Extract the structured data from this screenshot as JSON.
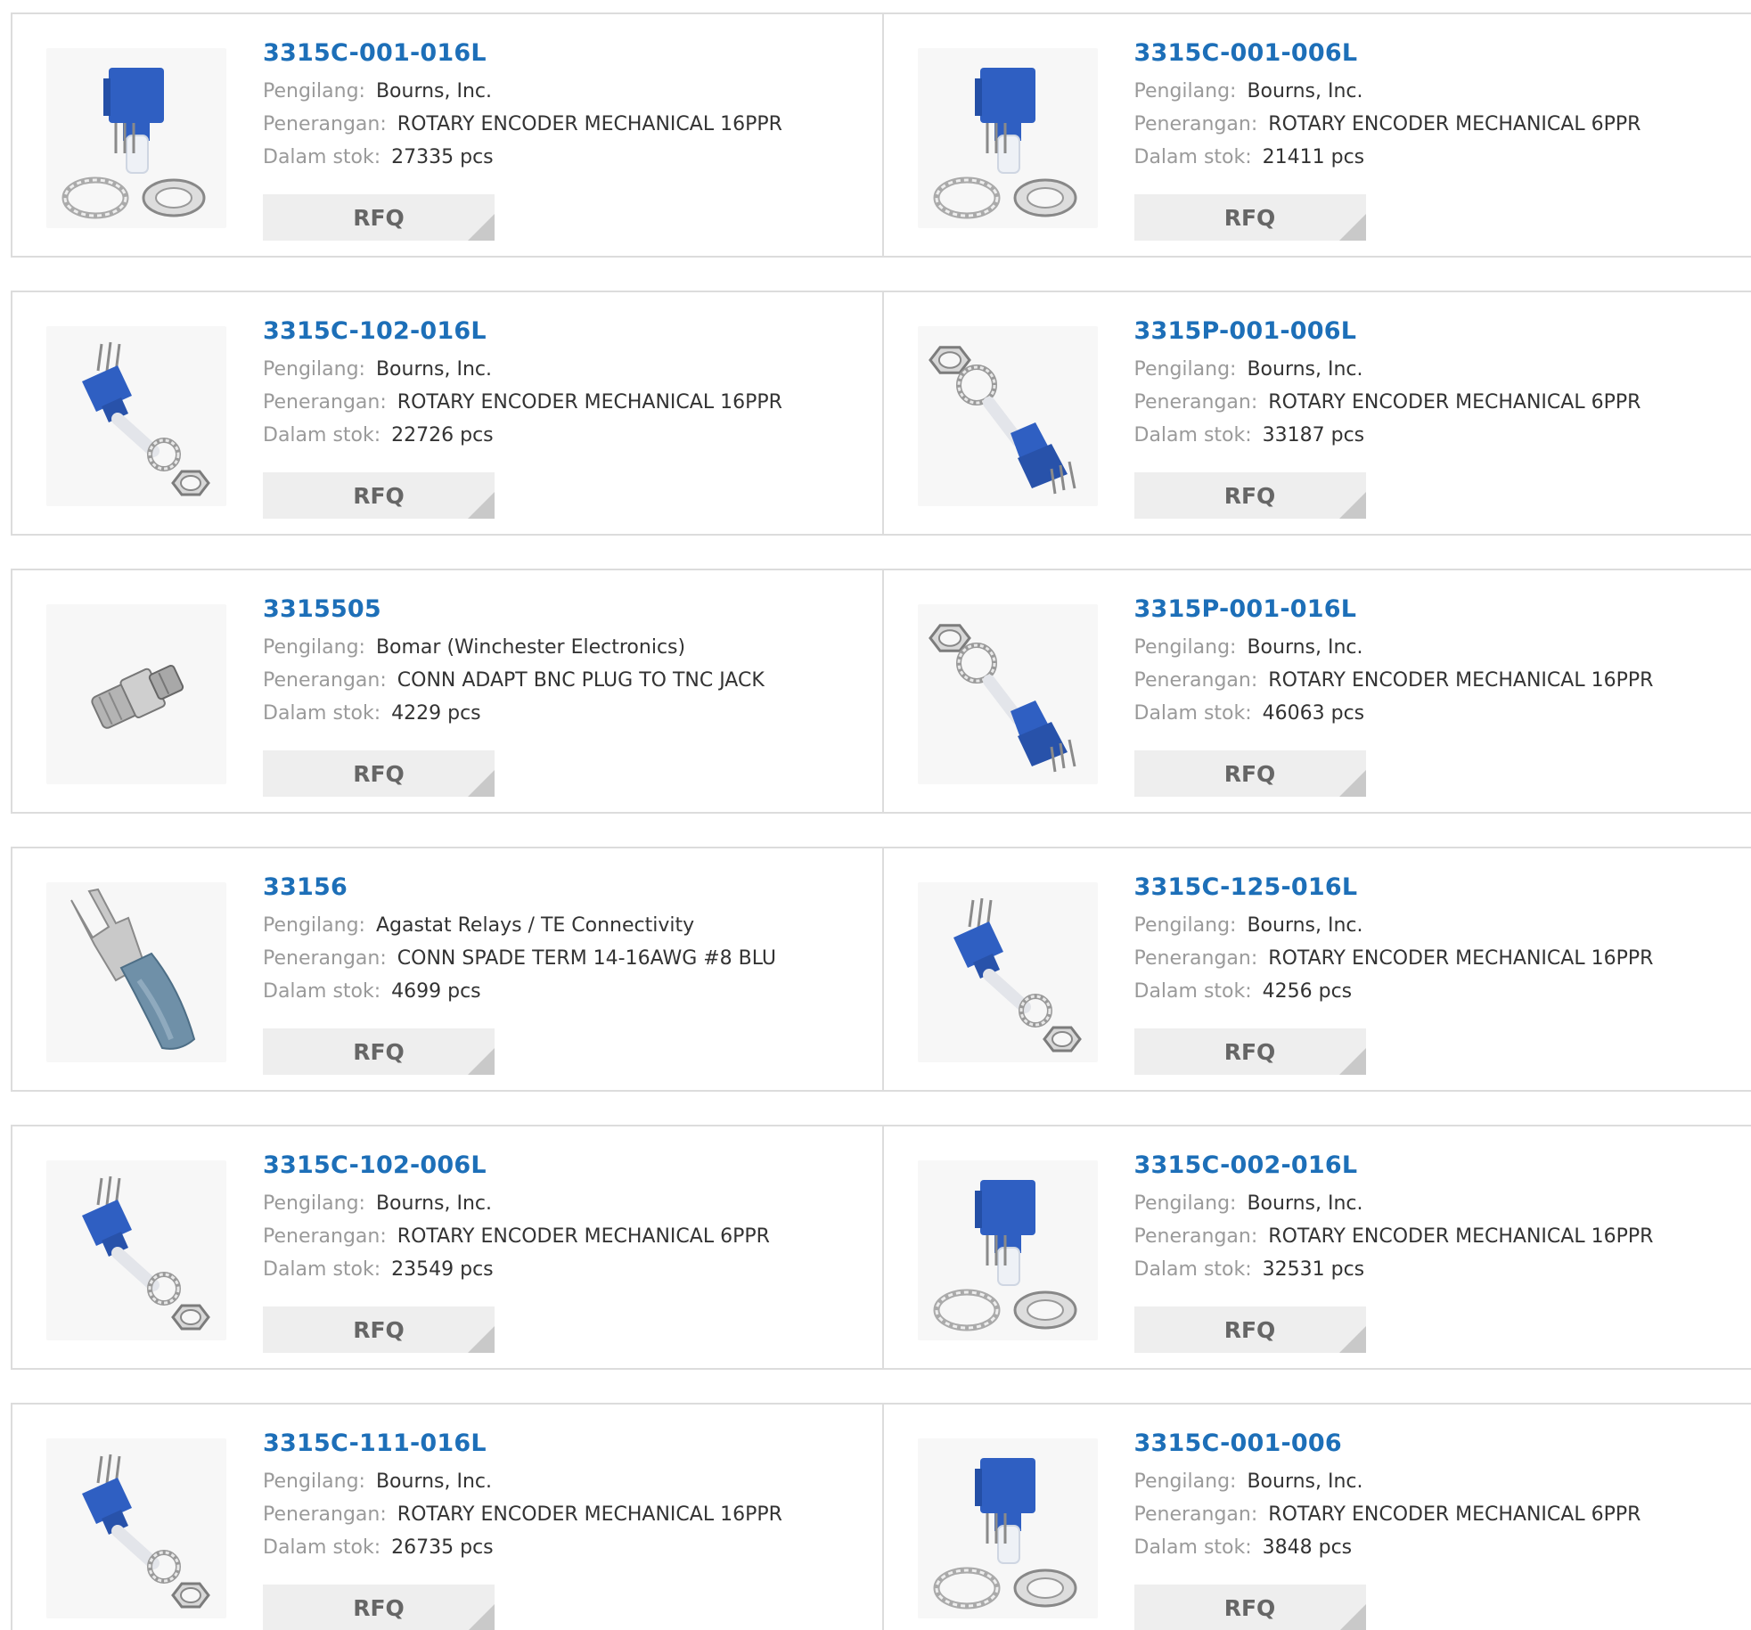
{
  "labels": {
    "manufacturer": "Pengilang:",
    "description": "Penerangan:",
    "stock": "Dalam stok:",
    "rfq": "RFQ"
  },
  "colors": {
    "link": "#1d6fb8",
    "encoder_blue": "#2f5fc2"
  },
  "products": [
    {
      "part": "3315C-001-016L",
      "manufacturer": "Bourns, Inc.",
      "description": "ROTARY ENCODER MECHANICAL 16PPR",
      "stock": "27335 pcs",
      "image": "encoder-upright-icon"
    },
    {
      "part": "3315C-001-006L",
      "manufacturer": "Bourns, Inc.",
      "description": "ROTARY ENCODER MECHANICAL 6PPR",
      "stock": "21411 pcs",
      "image": "encoder-upright-icon"
    },
    {
      "part": "3315C-102-016L",
      "manufacturer": "Bourns, Inc.",
      "description": "ROTARY ENCODER MECHANICAL 16PPR",
      "stock": "22726 pcs",
      "image": "encoder-angled-icon"
    },
    {
      "part": "3315P-001-006L",
      "manufacturer": "Bourns, Inc.",
      "description": "ROTARY ENCODER MECHANICAL 6PPR",
      "stock": "33187 pcs",
      "image": "encoder-panel-icon"
    },
    {
      "part": "3315505",
      "manufacturer": "Bomar (Winchester Electronics)",
      "description": "CONN ADAPT BNC PLUG TO TNC JACK",
      "stock": "4229 pcs",
      "image": "bnc-adapter-icon"
    },
    {
      "part": "3315P-001-016L",
      "manufacturer": "Bourns, Inc.",
      "description": "ROTARY ENCODER MECHANICAL 16PPR",
      "stock": "46063 pcs",
      "image": "encoder-panel-icon"
    },
    {
      "part": "33156",
      "manufacturer": "Agastat Relays / TE Connectivity",
      "description": "CONN SPADE TERM 14-16AWG #8 BLU",
      "stock": "4699 pcs",
      "image": "spade-terminal-icon"
    },
    {
      "part": "3315C-125-016L",
      "manufacturer": "Bourns, Inc.",
      "description": "ROTARY ENCODER MECHANICAL 16PPR",
      "stock": "4256 pcs",
      "image": "encoder-angled-icon"
    },
    {
      "part": "3315C-102-006L",
      "manufacturer": "Bourns, Inc.",
      "description": "ROTARY ENCODER MECHANICAL 6PPR",
      "stock": "23549 pcs",
      "image": "encoder-angled-icon"
    },
    {
      "part": "3315C-002-016L",
      "manufacturer": "Bourns, Inc.",
      "description": "ROTARY ENCODER MECHANICAL 16PPR",
      "stock": "32531 pcs",
      "image": "encoder-upright-icon"
    },
    {
      "part": "3315C-111-016L",
      "manufacturer": "Bourns, Inc.",
      "description": "ROTARY ENCODER MECHANICAL 16PPR",
      "stock": "26735 pcs",
      "image": "encoder-angled-icon"
    },
    {
      "part": "3315C-001-006",
      "manufacturer": "Bourns, Inc.",
      "description": "ROTARY ENCODER MECHANICAL 6PPR",
      "stock": "3848 pcs",
      "image": "encoder-upright-icon"
    }
  ]
}
